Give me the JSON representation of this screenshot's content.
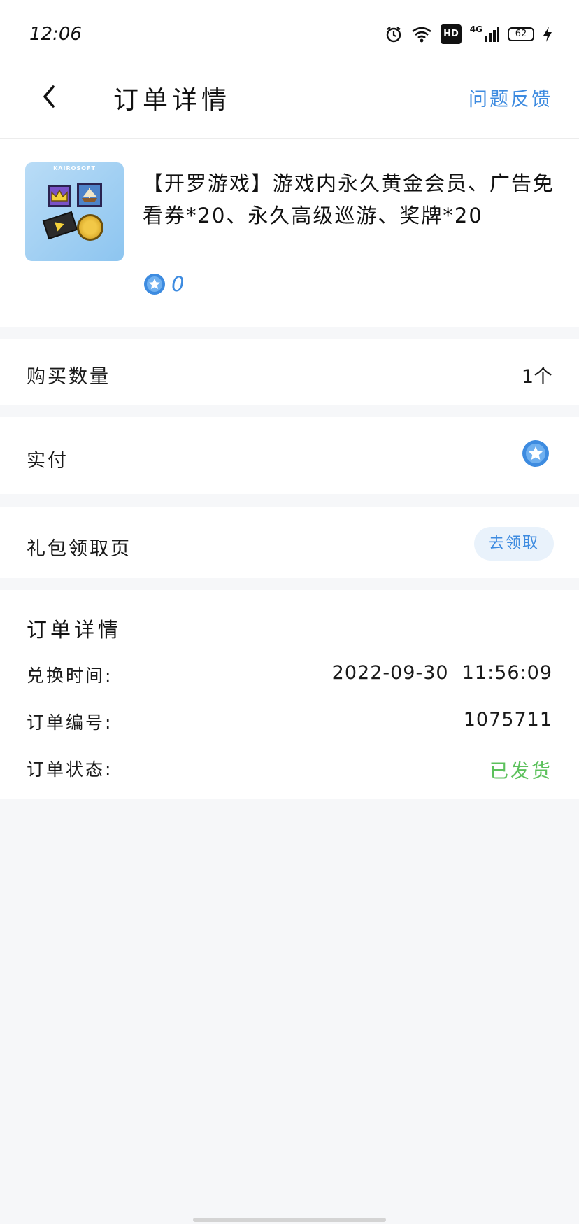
{
  "status_bar": {
    "time": "12:06",
    "network": "4G",
    "hd": "HD",
    "battery": "62"
  },
  "navbar": {
    "title": "订单详情",
    "feedback_label": "问题反馈"
  },
  "product": {
    "title": "【开罗游戏】游戏内永久黄金会员、广告免看券*20、永久高级巡游、奖牌*20",
    "price": "0",
    "thumb_caption": "KAIROSOFT"
  },
  "rows": {
    "quantity_label": "购买数量",
    "quantity_value": "1个",
    "paid_label": "实付",
    "gift_label": "礼包领取页",
    "claim_label": "去领取"
  },
  "details": {
    "title": "订单详情",
    "redeem_time_label": "兑换时间:",
    "redeem_time_value": "2022-09-30  11:56:09",
    "order_no_label": "订单编号:",
    "order_no_value": "1075711",
    "status_label": "订单状态:",
    "status_value": "已发货"
  },
  "colors": {
    "accent": "#3d8be0",
    "success": "#5cc15c",
    "background": "#f6f7f9"
  },
  "icons": [
    "alarm-icon",
    "wifi-icon",
    "signal-icon",
    "battery-icon",
    "charging-icon",
    "back-chevron-icon",
    "coin-icon"
  ]
}
